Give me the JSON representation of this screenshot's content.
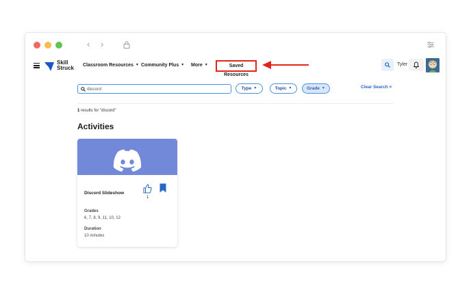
{
  "nav": {
    "items": [
      {
        "label": "Classroom Resources",
        "has_caret": true
      },
      {
        "label": "Community Plus",
        "has_caret": true
      },
      {
        "label": "More",
        "has_caret": true
      }
    ],
    "saved_label": "Saved Resources",
    "logo_line1": "Skill",
    "logo_line2": "Struck",
    "user_name": "Tyler"
  },
  "search": {
    "value": "discord",
    "placeholder": "Search"
  },
  "filters": [
    {
      "label": "Type",
      "active": false
    },
    {
      "label": "Topic",
      "active": false
    },
    {
      "label": "Grade",
      "active": true
    }
  ],
  "clear_search_label": "Clear Search ×",
  "results": {
    "count": "1",
    "text": " results for \"discord\""
  },
  "section_title": "Activities",
  "card": {
    "title": "Discord Slideshow",
    "likes": "1",
    "grades_label": "Grades",
    "grades_value": "6, 7, 8, 9, 11, 10, 12",
    "duration_label": "Duration",
    "duration_value": "10 minutes"
  },
  "colors": {
    "accent": "#2567c9",
    "highlight": "#e0251b",
    "discord": "#7289da"
  }
}
